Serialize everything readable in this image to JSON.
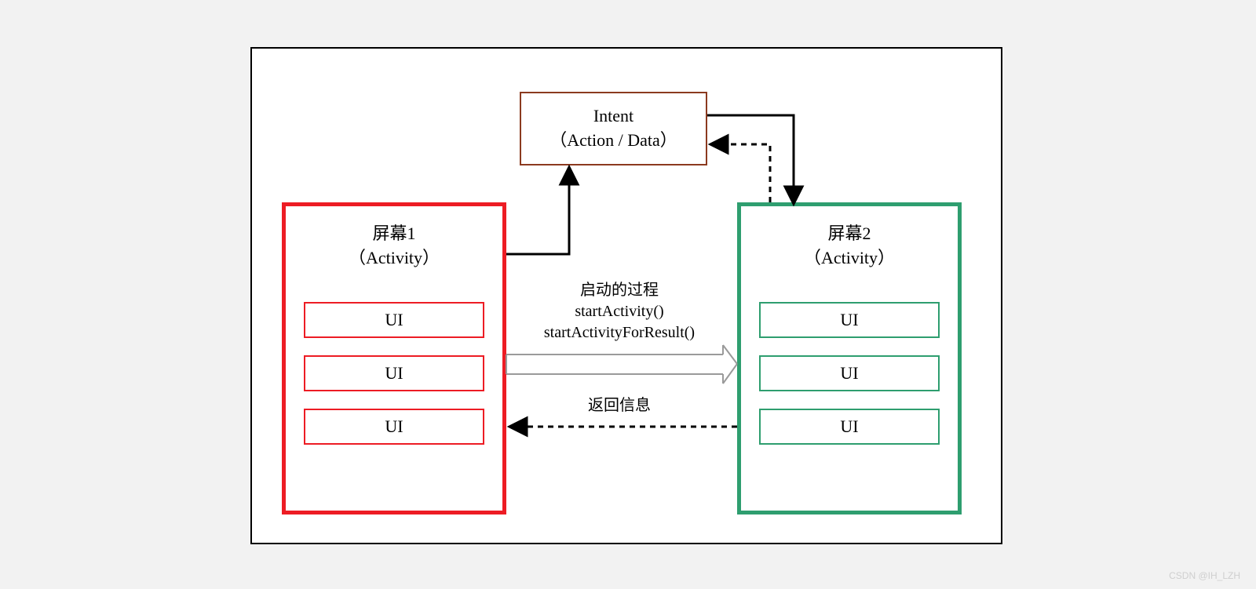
{
  "intent": {
    "title": "Intent",
    "subtitle": "（Action / Data）"
  },
  "screen1": {
    "title_line1": "屏幕1",
    "title_line2": "（Activity）",
    "ui": [
      "UI",
      "UI",
      "UI"
    ]
  },
  "screen2": {
    "title_line1": "屏幕2",
    "title_line2": "（Activity）",
    "ui": [
      "UI",
      "UI",
      "UI"
    ]
  },
  "labels": {
    "start_process": "启动的过程",
    "start_activity": "startActivity()",
    "start_activity_for_result": "startActivityForResult()",
    "return_info": "返回信息"
  },
  "watermark": "CSDN @IH_LZH",
  "colors": {
    "red": "#ed1c24",
    "green": "#2e9e6f",
    "brown": "#8b3a1f",
    "black": "#000000",
    "grey_arrow": "#9a9a9a"
  }
}
